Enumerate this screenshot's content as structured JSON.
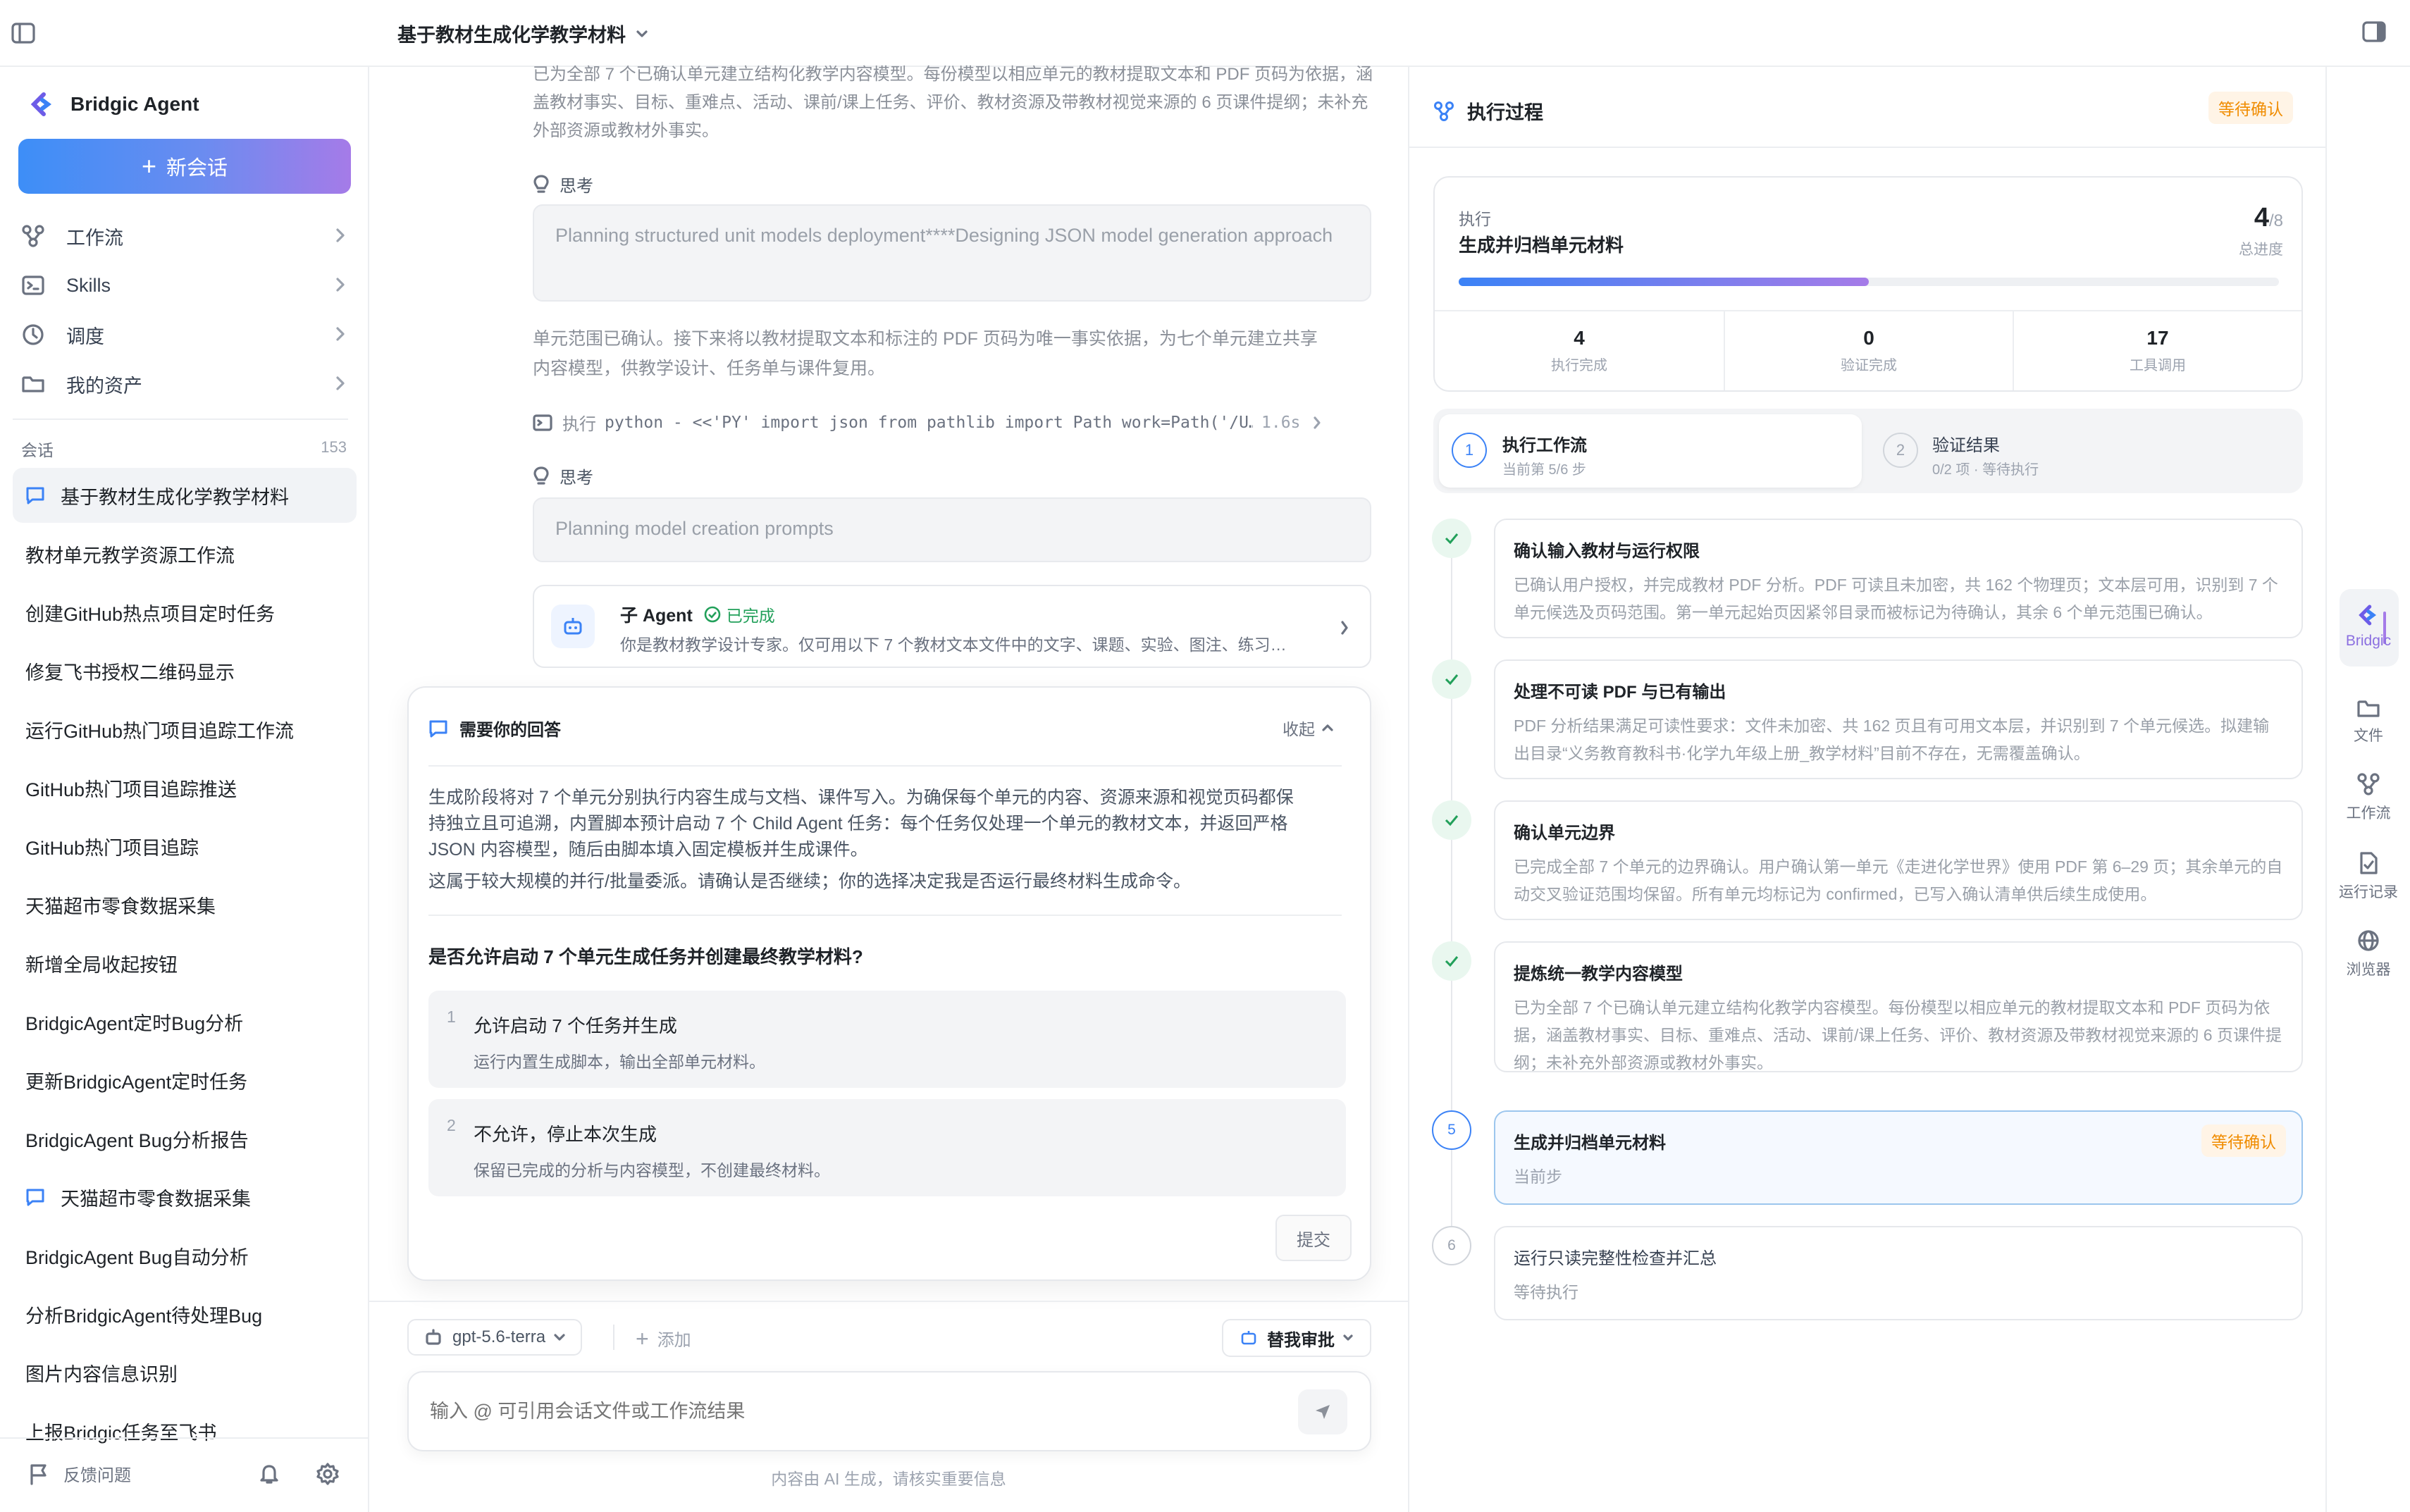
{
  "topbar": {
    "title": "基于教材生成化学教学材料"
  },
  "sidebar": {
    "brand": "Bridgic Agent",
    "new_chat": "新会话",
    "nav": [
      {
        "label": "工作流",
        "icon": "workflow-icon"
      },
      {
        "label": "Skills",
        "icon": "terminal-icon"
      },
      {
        "label": "调度",
        "icon": "clock-icon"
      },
      {
        "label": "我的资产",
        "icon": "folder-icon"
      }
    ],
    "section_label": "会话",
    "section_count": "153",
    "conversations": [
      {
        "label": "基于教材生成化学教学材料",
        "active": true,
        "icon": true
      },
      {
        "label": "教材单元教学资源工作流"
      },
      {
        "label": "创建GitHub热点项目定时任务"
      },
      {
        "label": "修复飞书授权二维码显示"
      },
      {
        "label": "运行GitHub热门项目追踪工作流"
      },
      {
        "label": "GitHub热门项目追踪推送"
      },
      {
        "label": "GitHub热门项目追踪"
      },
      {
        "label": "天猫超市零食数据采集"
      },
      {
        "label": "新增全局收起按钮"
      },
      {
        "label": "BridgicAgent定时Bug分析"
      },
      {
        "label": "更新BridgicAgent定时任务"
      },
      {
        "label": "BridgicAgent Bug分析报告"
      },
      {
        "label": "天猫超市零食数据采集",
        "icon": true
      },
      {
        "label": "BridgicAgent Bug自动分析"
      },
      {
        "label": "分析BridgicAgent待处理Bug"
      },
      {
        "label": "图片内容信息识别"
      },
      {
        "label": "上报Bridgic任务至飞书"
      }
    ],
    "feedback": "反馈问题"
  },
  "chat": {
    "top_text_1": "已为全部 7 个已确认单元建立结构化教学内容模型。每份模型以相应单元的教材提取文本和 PDF 页码为依据，涵",
    "top_text_2": "盖教材事实、目标、重难点、活动、课前/课上任务、评价、教材资源及带教材视觉来源的 6 页课件提纲；未补充",
    "top_text_3": "外部资源或教材外事实。",
    "think_label": "思考",
    "think_1": "Planning structured unit models deployment****Designing JSON model generation approach",
    "para_1": "单元范围已确认。接下来将以教材提取文本和标注的 PDF 页码为唯一事实依据，为七个单元建立共享",
    "para_2": "内容模型，供教学设计、任务单与课件复用。",
    "exec_label": "执行",
    "exec_cmd": "python - <<'PY' import json from pathlib import Path work=Path('/U…",
    "exec_time": "1.6s",
    "think_2": "Planning model creation prompts",
    "subagent_title": "子 Agent",
    "subagent_status": "已完成",
    "subagent_desc": "你是教材教学设计专家。仅可用以下 7 个教材文本文件中的文字、课题、实验、图注、练习…",
    "ask": {
      "title": "需要你的回答",
      "collapse": "收起",
      "body_1": "生成阶段将对 7 个单元分别执行内容生成与文档、课件写入。为确保每个单元的内容、资源来源和视觉页码都保",
      "body_2": "持独立且可追溯，内置脚本预计启动 7 个 Child Agent 任务：每个任务仅处理一个单元的教材文本，并返回严格",
      "body_3": "JSON 内容模型，随后由脚本填入固定模板并生成课件。",
      "body_4": "这属于较大规模的并行/批量委派。请确认是否继续；你的选择决定我是否运行最终材料生成命令。",
      "question": "是否允许启动 7 个单元生成任务并创建最终教学材料?",
      "options": [
        {
          "num": "1",
          "title": "允许启动 7 个任务并生成",
          "desc": "运行内置生成脚本，输出全部单元材料。"
        },
        {
          "num": "2",
          "title": "不允许，停止本次生成",
          "desc": "保留已完成的分析与内容模型，不创建最终材料。"
        }
      ],
      "submit": "提交"
    },
    "model": "gpt-5.6-terra",
    "add": "添加",
    "approve": "替我审批",
    "input_placeholder": "输入 @ 可引用会话文件或工作流结果",
    "disclaimer": "内容由 AI 生成，请核实重要信息"
  },
  "panel": {
    "title": "执行过程",
    "status": "等待确认",
    "exec_label": "执行",
    "exec_task": "生成并归档单元材料",
    "progress_num": "4",
    "progress_total": "/8",
    "progress_label": "总进度",
    "progress_fraction": 0.5,
    "stats": [
      {
        "value": "4",
        "label": "执行完成"
      },
      {
        "value": "0",
        "label": "验证完成"
      },
      {
        "value": "17",
        "label": "工具调用"
      }
    ],
    "tabs": [
      {
        "num": "1",
        "title": "执行工作流",
        "sub": "当前第 5/6 步"
      },
      {
        "num": "2",
        "title": "验证结果",
        "sub": "0/2 项 · 等待执行"
      }
    ],
    "steps": [
      {
        "title": "确认输入教材与运行权限",
        "desc": "已确认用户授权，并完成教材 PDF 分析。PDF 可读且未加密，共 162 个物理页；文本层可用，识别到 7 个单元候选及页码范围。第一单元起始页因紧邻目录而被标记为待确认，其余 6 个单元范围已确认。"
      },
      {
        "title": "处理不可读 PDF 与已有输出",
        "desc": "PDF 分析结果满足可读性要求：文件未加密、共 162 页且有可用文本层，并识别到 7 个单元候选。拟建输出目录“义务教育教科书·化学九年级上册_教学材料”目前不存在，无需覆盖确认。"
      },
      {
        "title": "确认单元边界",
        "desc": "已完成全部 7 个单元的边界确认。用户确认第一单元《走进化学世界》使用 PDF 第 6–29 页；其余单元的自动交叉验证范围均保留。所有单元均标记为 confirmed，已写入确认清单供后续生成使用。"
      },
      {
        "title": "提炼统一教学内容模型",
        "desc": "已为全部 7 个已确认单元建立结构化教学内容模型。每份模型以相应单元的教材提取文本和 PDF 页码为依据，涵盖教材事实、目标、重难点、活动、课前/课上任务、评价、教材资源及带教材视觉来源的 6 页课件提纲；未补充外部资源或教材外事实。"
      },
      {
        "num": "5",
        "title": "生成并归档单元材料",
        "desc": "当前步",
        "badge": "等待确认"
      },
      {
        "num": "6",
        "title": "运行只读完整性检查并汇总",
        "desc": "等待执行"
      }
    ]
  },
  "rail": [
    {
      "label": "Bridgic",
      "icon": "bridgic-logo-icon"
    },
    {
      "label": "文件",
      "icon": "folder-icon"
    },
    {
      "label": "工作流",
      "icon": "workflow-icon"
    },
    {
      "label": "运行记录",
      "icon": "record-icon"
    },
    {
      "label": "浏览器",
      "icon": "globe-icon"
    }
  ],
  "colors": {
    "accent": "#3b82f6",
    "accent_purple": "#a57be8",
    "warning": "#f08c00",
    "success": "#22a05a"
  }
}
